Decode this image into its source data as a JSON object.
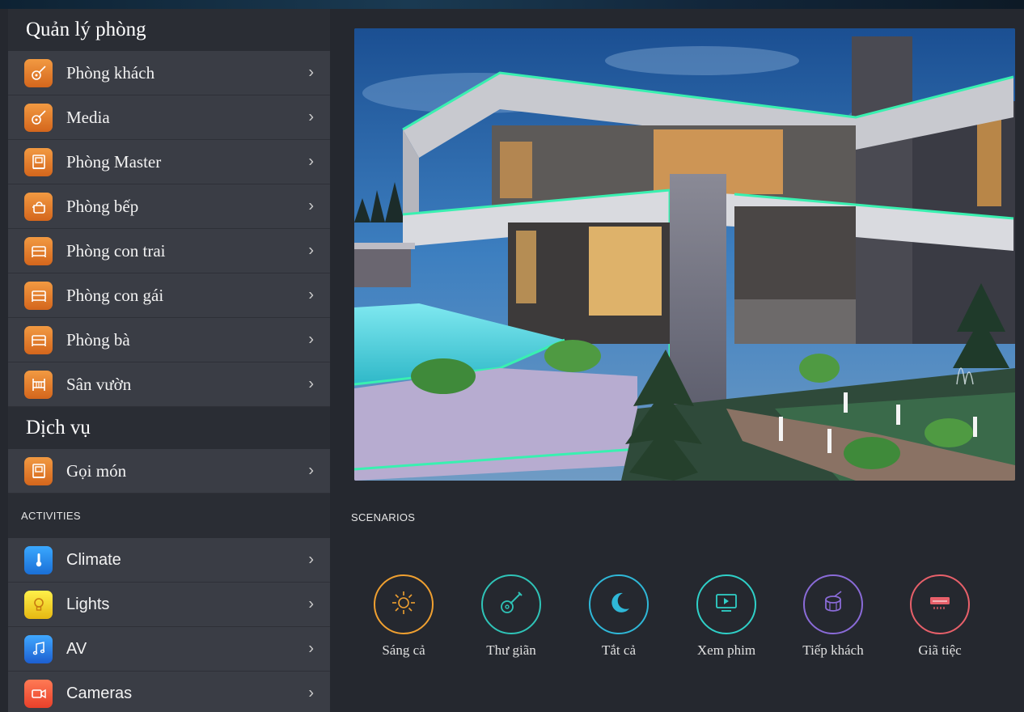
{
  "sidebar": {
    "room_section_title": "Quản lý phòng",
    "rooms": [
      {
        "label": "Phòng khách",
        "icon": "guitar-icon"
      },
      {
        "label": "Media",
        "icon": "guitar-icon"
      },
      {
        "label": "Phòng Master",
        "icon": "door-phone-icon"
      },
      {
        "label": "Phòng bếp",
        "icon": "kettle-icon"
      },
      {
        "label": "Phòng con trai",
        "icon": "bed-icon"
      },
      {
        "label": "Phòng con gái",
        "icon": "bed-icon"
      },
      {
        "label": "Phòng bà",
        "icon": "bed-icon"
      },
      {
        "label": "Sân vườn",
        "icon": "fence-icon"
      }
    ],
    "service_section_title": "Dịch vụ",
    "services": [
      {
        "label": "Gọi món",
        "icon": "door-phone-icon"
      }
    ],
    "activities_title": "ACTIVITIES",
    "activities": [
      {
        "label": "Climate",
        "icon": "thermometer-icon"
      },
      {
        "label": "Lights",
        "icon": "lightbulb-icon"
      },
      {
        "label": "AV",
        "icon": "music-note-icon"
      },
      {
        "label": "Cameras",
        "icon": "camera-icon"
      }
    ],
    "chevron": "›"
  },
  "scenarios": {
    "title": "SCENARIOS",
    "items": [
      {
        "label": "Sáng cả",
        "icon": "sun-icon",
        "color": "#f0a030"
      },
      {
        "label": "Thư giãn",
        "icon": "guitar-icon",
        "color": "#2fc4b8"
      },
      {
        "label": "Tắt cả",
        "icon": "moon-icon",
        "color": "#2fb8d8"
      },
      {
        "label": "Xem phim",
        "icon": "tv-icon",
        "color": "#2fd0c8"
      },
      {
        "label": "Tiếp khách",
        "icon": "drum-icon",
        "color": "#8a6bd8"
      },
      {
        "label": "Giã tiệc",
        "icon": "air-conditioner-icon",
        "color": "#e8606a"
      }
    ]
  },
  "colors": {
    "background": "#25282f",
    "sidebar": "#2a2d34",
    "row": "#3a3d45",
    "orange_icon": "#e07a28",
    "neon_green": "#39f0b0"
  }
}
